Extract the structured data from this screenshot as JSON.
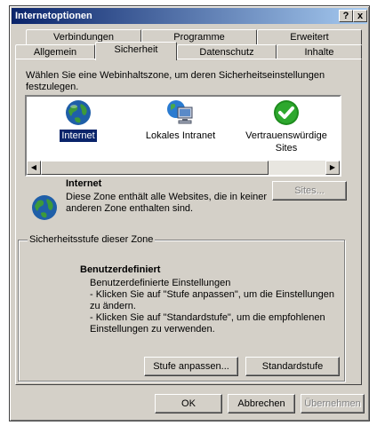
{
  "window": {
    "title": "Internetoptionen",
    "help_label": "?",
    "close_label": "x"
  },
  "tabs": {
    "row1": [
      "Verbindungen",
      "Programme",
      "Erweitert"
    ],
    "row2": [
      "Allgemein",
      "Sicherheit",
      "Datenschutz",
      "Inhalte"
    ],
    "active": "Sicherheit"
  },
  "zones": {
    "prompt_line1": "Wählen Sie eine Webinhaltszone, um deren Sicherheitseinstellungen",
    "prompt_line2": "festzulegen.",
    "items": [
      {
        "label": "Internet",
        "icon": "globe-icon"
      },
      {
        "label": "Lokales Intranet",
        "icon": "intranet-icon"
      },
      {
        "label": "Vertrauenswürdige",
        "label2": "Sites",
        "icon": "checkmark-icon"
      }
    ],
    "selected": "Internet"
  },
  "zone_info": {
    "title": "Internet",
    "desc_line1": "Diese Zone enthält alle Websites, die in keiner",
    "desc_line2": "anderen Zone enthalten sind.",
    "sites_button": "Sites..."
  },
  "security_level": {
    "group_title": "Sicherheitsstufe dieser Zone",
    "level_name": "Benutzerdefiniert",
    "lines": [
      "Benutzerdefinierte Einstellungen",
      "- Klicken Sie auf \"Stufe anpassen\", um die Einstellungen",
      "zu ändern.",
      "- Klicken Sie auf \"Standardstufe\", um die empfohlenen",
      "Einstellungen zu verwenden."
    ],
    "custom_button": "Stufe anpassen...",
    "default_button": "Standardstufe"
  },
  "footer": {
    "ok": "OK",
    "cancel": "Abbrechen",
    "apply": "Übernehmen"
  },
  "colors": {
    "titlebar_start": "#0a246a",
    "titlebar_end": "#a6caf0",
    "face": "#d4d0c8",
    "selection": "#0a246a"
  }
}
